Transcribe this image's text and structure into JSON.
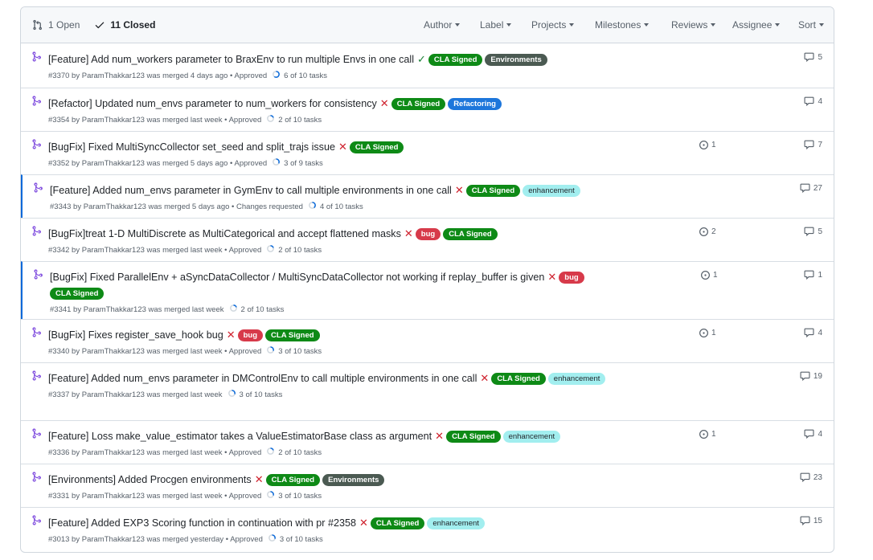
{
  "header": {
    "open_label": "1 Open",
    "closed_label": "11 Closed",
    "filters": [
      "Author",
      "Label",
      "Projects",
      "Milestones",
      "Reviews",
      "Assignee",
      "Sort"
    ]
  },
  "colors": {
    "merged_icon": "#8250df",
    "cla_signed": "#0e8a16",
    "environments": "#4b5a52",
    "refactoring": "#1d76db",
    "bug": "#d73a4a",
    "enhancement": "#a2eeef",
    "check": "#1a7f37",
    "cross": "#cf222e"
  },
  "prs": [
    {
      "title": "[Feature] Add num_workers parameter to BraxEnv to run multiple Envs in one call",
      "status": "✓",
      "status_type": "ok",
      "labels": [
        {
          "text": "CLA Signed",
          "kind": "cla"
        },
        {
          "text": "Environments",
          "kind": "env"
        }
      ],
      "number": "#3370",
      "author": "ParamThakkar123",
      "merged": "was merged 4 days ago",
      "review": "• Approved",
      "tasks": "6 of 10 tasks",
      "progress": 0.6,
      "issues": "",
      "comments": "5"
    },
    {
      "title": "[Refactor] Updated num_envs parameter to num_workers for consistency",
      "status": "✕",
      "status_type": "fail",
      "labels": [
        {
          "text": "CLA Signed",
          "kind": "cla"
        },
        {
          "text": "Refactoring",
          "kind": "ref"
        }
      ],
      "number": "#3354",
      "author": "ParamThakkar123",
      "merged": "was merged last week",
      "review": "• Approved",
      "tasks": "2 of 10 tasks",
      "progress": 0.2,
      "issues": "",
      "comments": "4"
    },
    {
      "title": "[BugFix] Fixed MultiSyncCollector set_seed and split_trajs issue",
      "status": "✕",
      "status_type": "fail",
      "labels": [
        {
          "text": "CLA Signed",
          "kind": "cla"
        }
      ],
      "number": "#3352",
      "author": "ParamThakkar123",
      "merged": "was merged 5 days ago",
      "review": "• Approved",
      "tasks": "3 of 9 tasks",
      "progress": 0.333,
      "issues": "1",
      "comments": "7"
    },
    {
      "title": "[Feature] Added num_envs parameter in GymEnv to call multiple environments in one call",
      "status": "✕",
      "status_type": "fail",
      "labels": [
        {
          "text": "CLA Signed",
          "kind": "cla"
        },
        {
          "text": "enhancement",
          "kind": "enh"
        }
      ],
      "number": "#3343",
      "author": "ParamThakkar123",
      "merged": "was merged 5 days ago",
      "review": "• Changes requested",
      "tasks": "4 of 10 tasks",
      "progress": 0.4,
      "issues": "",
      "comments": "27"
    },
    {
      "title": "[BugFix]treat 1-D MultiDiscrete as MultiCategorical and accept flattened masks",
      "status": "✕",
      "status_type": "fail",
      "labels": [
        {
          "text": "bug",
          "kind": "bug"
        },
        {
          "text": "CLA Signed",
          "kind": "cla"
        }
      ],
      "number": "#3342",
      "author": "ParamThakkar123",
      "merged": "was merged last week",
      "review": "• Approved",
      "tasks": "2 of 10 tasks",
      "progress": 0.2,
      "issues": "2",
      "comments": "5"
    },
    {
      "title": "[BugFix] Fixed ParallelEnv + aSyncDataCollector / MultiSyncDataCollector not working if replay_buffer is given",
      "status": "✕",
      "status_type": "fail",
      "labels": [
        {
          "text": "bug",
          "kind": "bug"
        },
        {
          "text": "CLA Signed",
          "kind": "cla"
        }
      ],
      "number": "#3341",
      "author": "ParamThakkar123",
      "merged": "was merged last week",
      "review": "",
      "tasks": "2 of 10 tasks",
      "progress": 0.2,
      "issues": "1",
      "comments": "1"
    },
    {
      "title": "[BugFix] Fixes register_save_hook bug",
      "status": "✕",
      "status_type": "fail",
      "labels": [
        {
          "text": "bug",
          "kind": "bug"
        },
        {
          "text": "CLA Signed",
          "kind": "cla"
        }
      ],
      "number": "#3340",
      "author": "ParamThakkar123",
      "merged": "was merged last week",
      "review": "• Approved",
      "tasks": "3 of 10 tasks",
      "progress": 0.3,
      "issues": "1",
      "comments": "4"
    },
    {
      "title": "[Feature] Added num_envs parameter in DMControlEnv to call multiple environments in one call",
      "status": "✕",
      "status_type": "fail",
      "labels": [
        {
          "text": "CLA Signed",
          "kind": "cla"
        },
        {
          "text": "enhancement",
          "kind": "enh"
        }
      ],
      "number": "#3337",
      "author": "ParamThakkar123",
      "merged": "was merged last week",
      "review": "",
      "tasks": "3 of 10 tasks",
      "progress": 0.3,
      "issues": "",
      "comments": "19"
    },
    {
      "title": "[Feature] Loss make_value_estimator takes a ValueEstimatorBase class as argument",
      "status": "✕",
      "status_type": "fail",
      "labels": [
        {
          "text": "CLA Signed",
          "kind": "cla"
        },
        {
          "text": "enhancement",
          "kind": "enh"
        }
      ],
      "number": "#3336",
      "author": "ParamThakkar123",
      "merged": "was merged last week",
      "review": "• Approved",
      "tasks": "2 of 10 tasks",
      "progress": 0.2,
      "issues": "1",
      "comments": "4"
    },
    {
      "title": "[Environments] Added Procgen environments",
      "status": "✕",
      "status_type": "fail",
      "labels": [
        {
          "text": "CLA Signed",
          "kind": "cla"
        },
        {
          "text": "Environments",
          "kind": "env"
        }
      ],
      "number": "#3331",
      "author": "ParamThakkar123",
      "merged": "was merged last week",
      "review": "• Approved",
      "tasks": "3 of 10 tasks",
      "progress": 0.3,
      "issues": "",
      "comments": "23"
    },
    {
      "title": "[Feature] Added EXP3 Scoring function in continuation with pr #2358",
      "status": "✕",
      "status_type": "fail",
      "labels": [
        {
          "text": "CLA Signed",
          "kind": "cla"
        },
        {
          "text": "enhancement",
          "kind": "enh"
        }
      ],
      "number": "#3013",
      "author": "ParamThakkar123",
      "merged": "was merged yesterday",
      "review": "• Approved",
      "tasks": "3 of 10 tasks",
      "progress": 0.3,
      "issues": "",
      "comments": "15"
    }
  ]
}
